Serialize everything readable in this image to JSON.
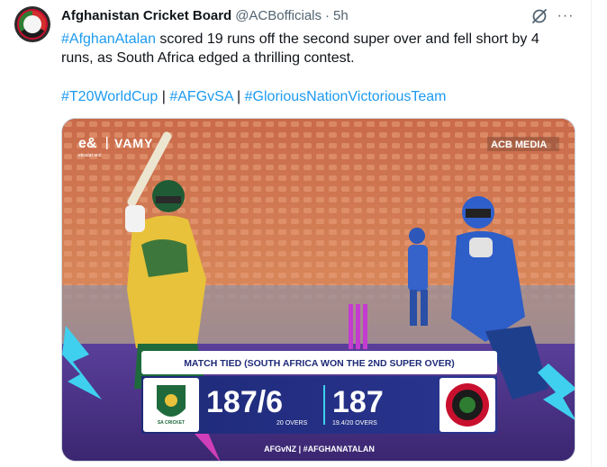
{
  "tweet": {
    "author_name": "Afghanistan Cricket Board",
    "handle": "@ACBofficials",
    "separator": "·",
    "time": "5h",
    "more_label": "···",
    "text": {
      "hashtag1": "#AfghanAtalan",
      "line1_rest": " scored 19 runs off the second super over and fell short by 4",
      "line2": "runs, as South Africa edged a thrilling contest.",
      "tag1": "#T20WorldCup",
      "sep": " | ",
      "tag2": "#AFGvSA",
      "tag3": "#GloriousNationVictoriousTeam"
    }
  },
  "media": {
    "sponsor_left": "e&",
    "sponsor_sub": "etisalat and",
    "sponsor_right": "VAMY",
    "brand_tag": "ACB MEDIA",
    "headline": "MATCH TIED (SOUTH AFRICA WON THE 2ND SUPER OVER)",
    "sa_score": "187/6",
    "sa_overs": "20 OVERS",
    "afg_score": "187",
    "afg_overs": "19.4/20 OVERS",
    "sa_crest_text": "SA CRICKET",
    "footer_hashtags": "AFGvNZ | #AFGHANATALAN",
    "colors": {
      "accent_cyan": "#3fd0f0",
      "accent_magenta": "#e040c0",
      "panel_blue": "#1e2a78"
    }
  }
}
